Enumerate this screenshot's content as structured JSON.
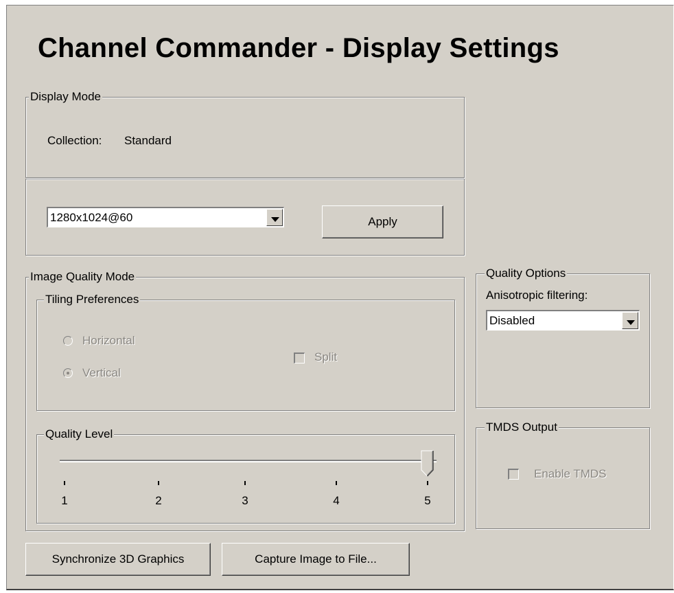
{
  "title": "Channel Commander - Display Settings",
  "display_mode": {
    "legend": "Display Mode",
    "collection_label": "Collection:",
    "collection_value": "Standard",
    "resolution_value": "1280x1024@60",
    "apply_label": "Apply"
  },
  "image_quality": {
    "legend": "Image Quality Mode",
    "tiling": {
      "legend": "Tiling Preferences",
      "horizontal_label": "Horizontal",
      "vertical_label": "Vertical",
      "selected": "Vertical",
      "split_label": "Split",
      "split_checked": false,
      "enabled": false
    },
    "quality_level": {
      "legend": "Quality Level",
      "ticks": [
        "1",
        "2",
        "3",
        "4",
        "5"
      ],
      "value": 5
    }
  },
  "quality_options": {
    "legend": "Quality Options",
    "aniso_label": "Anisotropic filtering:",
    "aniso_value": "Disabled"
  },
  "tmds": {
    "legend": "TMDS Output",
    "enable_label": "Enable TMDS",
    "checked": false,
    "enabled": false
  },
  "buttons": {
    "sync_label": "Synchronize 3D Graphics",
    "capture_label": "Capture Image to File..."
  },
  "colors": {
    "face": "#d4d0c8",
    "disabled_text": "#8a8782"
  }
}
